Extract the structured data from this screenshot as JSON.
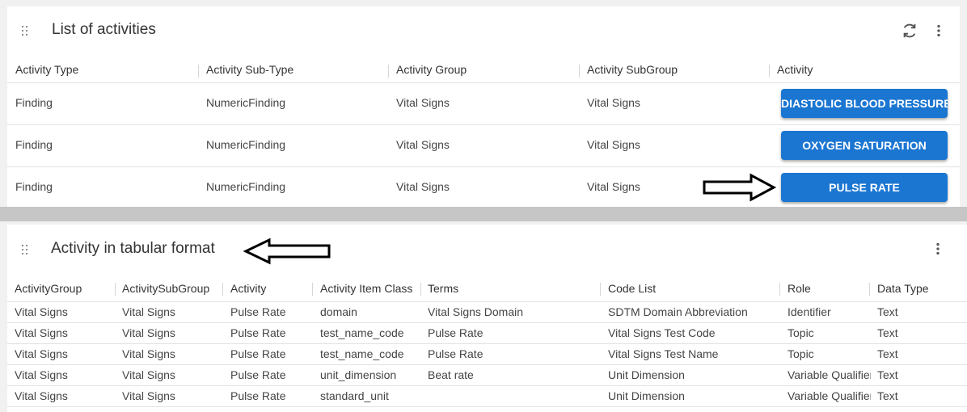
{
  "activities_panel": {
    "title": "List of activities",
    "columns": [
      "Activity Type",
      "Activity Sub-Type",
      "Activity Group",
      "Activity SubGroup",
      "Activity"
    ],
    "rows": [
      {
        "type": "Finding",
        "subtype": "NumericFinding",
        "group": "Vital Signs",
        "subgroup": "Vital Signs",
        "activity": "DIASTOLIC BLOOD PRESSURE"
      },
      {
        "type": "Finding",
        "subtype": "NumericFinding",
        "group": "Vital Signs",
        "subgroup": "Vital Signs",
        "activity": "OXYGEN SATURATION"
      },
      {
        "type": "Finding",
        "subtype": "NumericFinding",
        "group": "Vital Signs",
        "subgroup": "Vital Signs",
        "activity": "PULSE RATE"
      }
    ],
    "icons": [
      "drag-handle-icon",
      "refresh-icon",
      "more-vert-icon"
    ],
    "button_color": "#1b76d2"
  },
  "tabular_panel": {
    "title": "Activity in tabular format",
    "columns": [
      "ActivityGroup",
      "ActivitySubGroup",
      "Activity",
      "Activity Item Class",
      "Terms",
      "Code List",
      "Role",
      "Data Type"
    ],
    "rows": [
      [
        "Vital Signs",
        "Vital Signs",
        "Pulse Rate",
        "domain",
        "Vital Signs Domain",
        "SDTM Domain Abbreviation",
        "Identifier",
        "Text"
      ],
      [
        "Vital Signs",
        "Vital Signs",
        "Pulse Rate",
        "test_name_code",
        "Pulse Rate",
        "Vital Signs Test Code",
        "Topic",
        "Text"
      ],
      [
        "Vital Signs",
        "Vital Signs",
        "Pulse Rate",
        "test_name_code",
        "Pulse Rate",
        "Vital Signs Test Name",
        "Topic",
        "Text"
      ],
      [
        "Vital Signs",
        "Vital Signs",
        "Pulse Rate",
        "unit_dimension",
        "Beat rate",
        "Unit Dimension",
        "Variable Qualifier",
        "Text"
      ],
      [
        "Vital Signs",
        "Vital Signs",
        "Pulse Rate",
        "standard_unit",
        "",
        "Unit Dimension",
        "Variable Qualifier",
        "Text"
      ]
    ],
    "icons": [
      "drag-handle-icon",
      "more-vert-icon"
    ]
  }
}
